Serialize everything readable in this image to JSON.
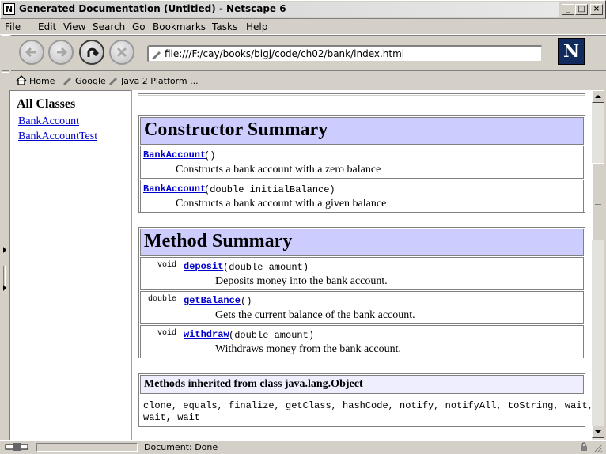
{
  "window": {
    "title": "Generated Documentation (Untitled) - Netscape 6",
    "app_icon": "N",
    "controls": {
      "minimize": "_",
      "maximize": "□",
      "close": "×"
    }
  },
  "menubar": [
    "File",
    "Edit",
    "View",
    "Search",
    "Go",
    "Bookmarks",
    "Tasks",
    "Help"
  ],
  "navigation": {
    "url": "file:///F:/cay/books/bigj/code/ch02/bank/index.html",
    "logo": "N"
  },
  "personal_toolbar": [
    "Home",
    "Google",
    "Java 2 Platform ..."
  ],
  "left_frame": {
    "heading": "All Classes",
    "links": [
      "BankAccount",
      "BankAccountTest"
    ]
  },
  "content": {
    "constructor_summary": {
      "title": "Constructor Summary",
      "rows": [
        {
          "name": "BankAccount",
          "sig": "()",
          "desc": "Constructs a bank account with a zero balance"
        },
        {
          "name": "BankAccount",
          "sig": "(double initialBalance)",
          "desc": "Constructs a bank account with a given balance"
        }
      ]
    },
    "method_summary": {
      "title": "Method Summary",
      "rows": [
        {
          "type": "void",
          "name": "deposit",
          "sig": "(double amount)",
          "desc": "Deposits money into the bank account."
        },
        {
          "type": "double",
          "name": "getBalance",
          "sig": "()",
          "desc": "Gets the current balance of the bank account."
        },
        {
          "type": "void",
          "name": "withdraw",
          "sig": "(double amount)",
          "desc": "Withdraws money from the bank account."
        }
      ]
    },
    "inherited": {
      "title": "Methods inherited from class java.lang.Object",
      "line1": "clone, equals, finalize, getClass, hashCode, notify, notifyAll, toString, wait,",
      "line2": "wait, wait"
    }
  },
  "status": {
    "text": "Document: Done"
  },
  "colors": {
    "table_header": "#ccccff",
    "inherited_header": "#eeeeff",
    "link": "#0000cc"
  }
}
